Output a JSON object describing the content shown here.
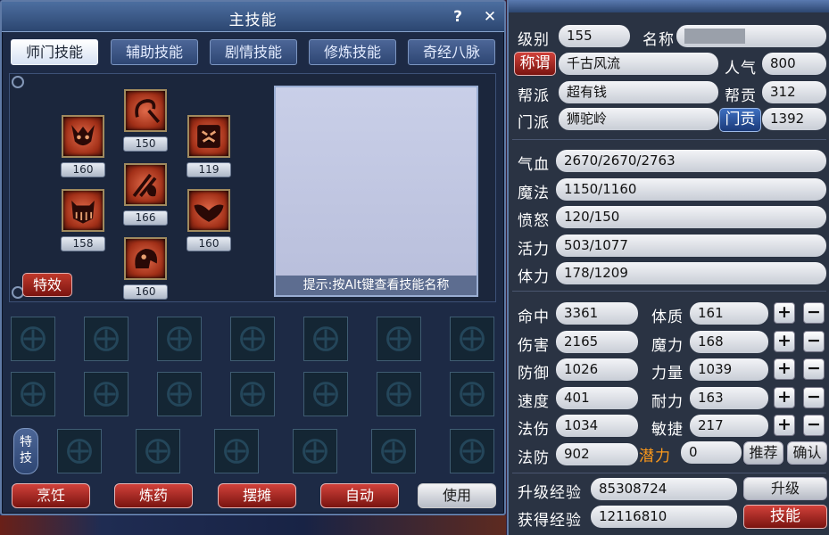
{
  "skill_window": {
    "title": "主技能",
    "help_label": "?",
    "close_label": "✕",
    "tabs": [
      "师门技能",
      "辅助技能",
      "剧情技能",
      "修炼技能",
      "奇经八脉"
    ],
    "active_tab": "师门技能",
    "skills": [
      {
        "level": "150",
        "icon": "hook-weapon-icon"
      },
      {
        "level": "160",
        "icon": "horned-demon-icon"
      },
      {
        "level": "119",
        "icon": "roaring-beast-icon"
      },
      {
        "level": "166",
        "icon": "lion-claw-icon"
      },
      {
        "level": "158",
        "icon": "fanged-mask-icon"
      },
      {
        "level": "160",
        "icon": "bat-wings-icon"
      },
      {
        "level": "160",
        "icon": "screaming-demon-icon"
      }
    ],
    "preview_hint": "提示:按Alt键查看技能名称",
    "effects_button": "特效",
    "special_skills_label": "特技",
    "actions": [
      "烹饪",
      "炼药",
      "摆摊",
      "自动",
      "使用"
    ]
  },
  "status_window": {
    "level_label": "级别",
    "level": "155",
    "name_label": "名称",
    "name_value": "",
    "title_button": "称谓",
    "title_value": "千古风流",
    "popularity_label": "人气",
    "popularity": "800",
    "guild_label": "帮派",
    "guild": "超有钱",
    "guild_contrib_label": "帮贡",
    "guild_contrib": "312",
    "school_label": "门派",
    "school": "狮驼岭",
    "school_contrib_button": "门贡",
    "school_contrib": "1392",
    "vitals": [
      {
        "label": "气血",
        "value": "2670/2670/2763"
      },
      {
        "label": "魔法",
        "value": "1150/1160"
      },
      {
        "label": "愤怒",
        "value": "120/150"
      },
      {
        "label": "活力",
        "value": "503/1077"
      },
      {
        "label": "体力",
        "value": "178/1209"
      }
    ],
    "combat_stats": [
      {
        "label": "命中",
        "value": "3361"
      },
      {
        "label": "伤害",
        "value": "2165"
      },
      {
        "label": "防御",
        "value": "1026"
      },
      {
        "label": "速度",
        "value": "401"
      },
      {
        "label": "法伤",
        "value": "1034"
      },
      {
        "label": "法防",
        "value": "902"
      }
    ],
    "attributes": [
      {
        "label": "体质",
        "value": "161"
      },
      {
        "label": "魔力",
        "value": "168"
      },
      {
        "label": "力量",
        "value": "1039"
      },
      {
        "label": "耐力",
        "value": "163"
      },
      {
        "label": "敏捷",
        "value": "217"
      }
    ],
    "potential_label": "潜力",
    "potential": "0",
    "plus": "+",
    "minus": "−",
    "recommend_button": "推荐",
    "confirm_button": "确认",
    "upgrade_exp_label": "升级经验",
    "upgrade_exp": "85308724",
    "upgrade_button": "升级",
    "gained_exp_label": "获得经验",
    "gained_exp": "12116810",
    "skills_button": "技能"
  },
  "colors": {
    "accent_red": "#c0392b",
    "potential_orange": "#ff9a1a",
    "panel_blue": "#2e4673"
  }
}
